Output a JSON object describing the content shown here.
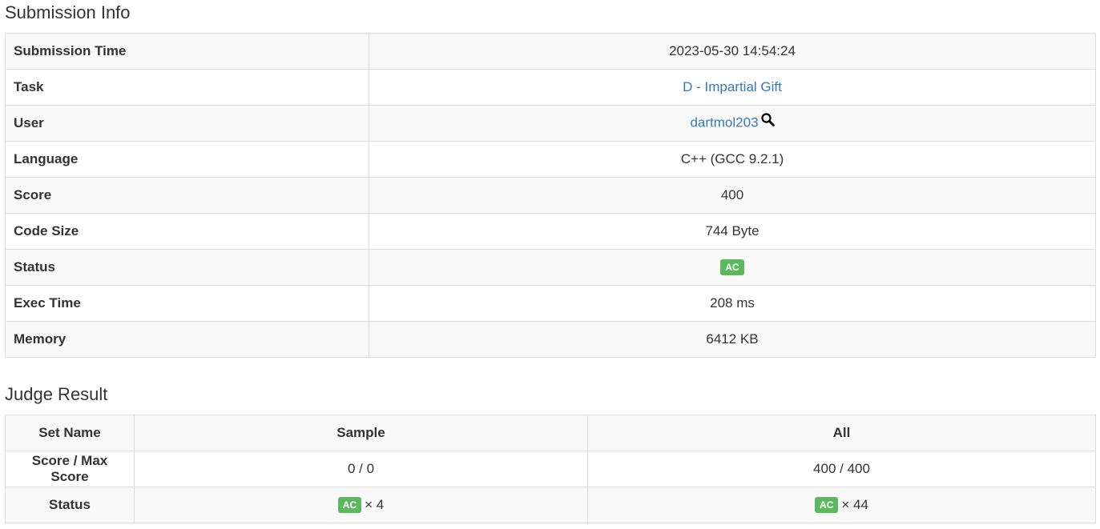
{
  "submission_info": {
    "heading": "Submission Info",
    "rows": [
      {
        "label": "Submission Time",
        "value": "2023-05-30 14:54:24"
      },
      {
        "label": "Task",
        "value": "D - Impartial Gift"
      },
      {
        "label": "User",
        "value": "dartmol203"
      },
      {
        "label": "Language",
        "value": "C++ (GCC 9.2.1)"
      },
      {
        "label": "Score",
        "value": "400"
      },
      {
        "label": "Code Size",
        "value": "744 Byte"
      },
      {
        "label": "Status",
        "value": "AC"
      },
      {
        "label": "Exec Time",
        "value": "208 ms"
      },
      {
        "label": "Memory",
        "value": "6412 KB"
      }
    ]
  },
  "judge_result": {
    "heading": "Judge Result",
    "headers": [
      "Set Name",
      "Sample",
      "All"
    ],
    "score_row": {
      "label": "Score / Max Score",
      "sample": "0 / 0",
      "all": "400 / 400"
    },
    "status_row": {
      "label": "Status",
      "sample_badge": "AC",
      "sample_count": "× 4",
      "all_badge": "AC",
      "all_count": "× 44"
    }
  },
  "colors": {
    "link": "#337ab7",
    "ac_badge": "#5cb85c",
    "stripe": "#f9f9f9",
    "border": "#dddddd"
  },
  "icons": {
    "user_search": "search-icon"
  }
}
